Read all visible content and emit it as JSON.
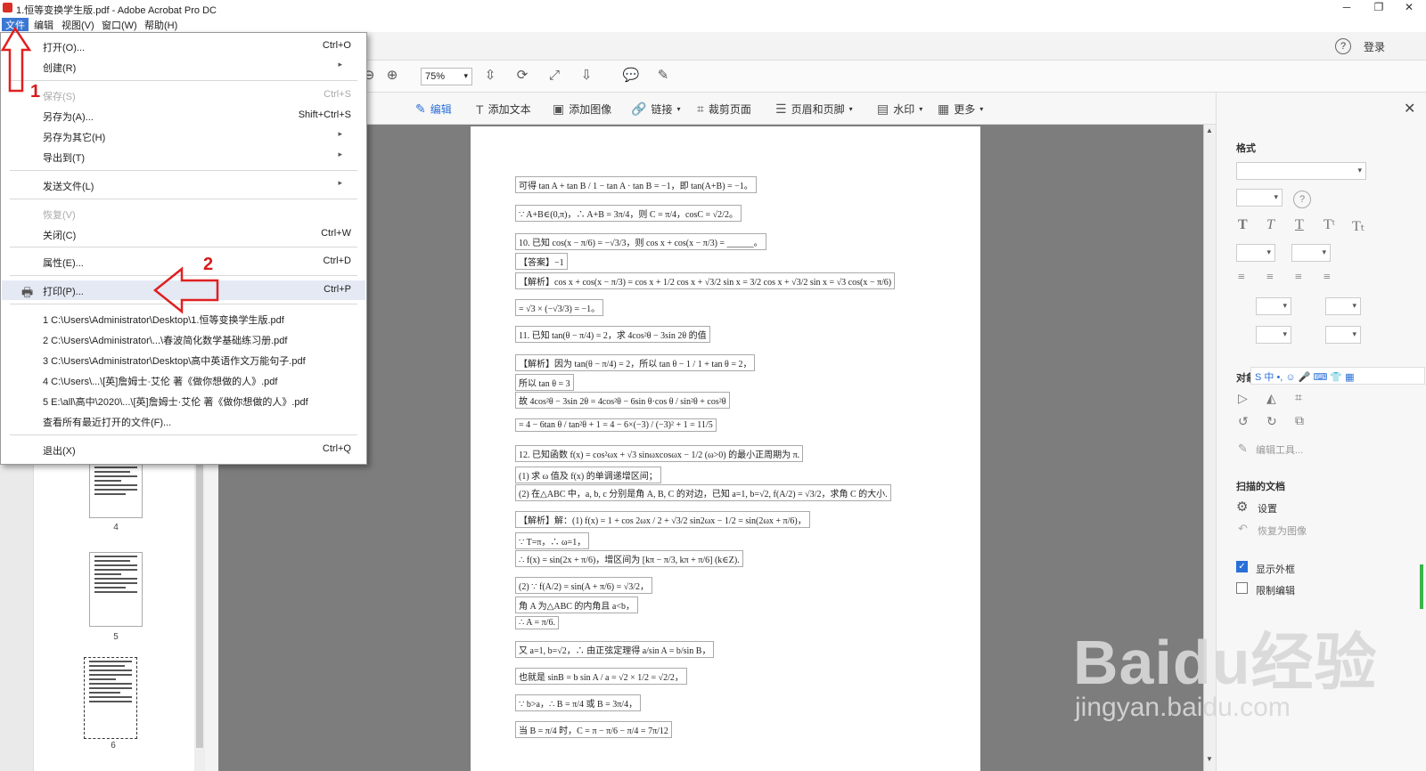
{
  "window": {
    "title": "1.恒等变换学生版.pdf - Adobe Acrobat Pro DC",
    "minimize": "─",
    "restore": "❐",
    "close": "✕"
  },
  "menubar": [
    "文件",
    "编辑",
    "视图(V)",
    "窗口(W)",
    "帮助(H)"
  ],
  "header": {
    "help": "?",
    "login": "登录"
  },
  "toolbar": {
    "zoom": "75%"
  },
  "edit_tools": [
    "编辑",
    "添加文本",
    "添加图像",
    "链接",
    "裁剪页面",
    "页眉和页脚",
    "水印",
    "更多"
  ],
  "file_menu": {
    "items": [
      {
        "label": "打开(O)...",
        "shortcut": "Ctrl+O"
      },
      {
        "label": "创建(R)",
        "shortcut": "",
        "submenu": true
      },
      {
        "label": "保存(S)",
        "shortcut": "Ctrl+S",
        "disabled": true
      },
      {
        "label": "另存为(A)...",
        "shortcut": "Shift+Ctrl+S"
      },
      {
        "label": "另存为其它(H)",
        "shortcut": "",
        "submenu": true
      },
      {
        "label": "导出到(T)",
        "shortcut": "",
        "submenu": true
      },
      {
        "label": "发送文件(L)",
        "shortcut": "",
        "submenu": true
      },
      {
        "label": "恢复(V)",
        "shortcut": "",
        "disabled": true
      },
      {
        "label": "关闭(C)",
        "shortcut": "Ctrl+W"
      },
      {
        "label": "属性(E)...",
        "shortcut": "Ctrl+D"
      },
      {
        "label": "打印(P)...",
        "shortcut": "Ctrl+P",
        "highlighted": true
      }
    ],
    "recent": [
      "1 C:\\Users\\Administrator\\Desktop\\1.恒等变换学生版.pdf",
      "2 C:\\Users\\Administrator\\...\\春波简化数学基础练习册.pdf",
      "3 C:\\Users\\Administrator\\Desktop\\高中英语作文万能句子.pdf",
      "4 C:\\Users\\...\\[英]詹姆士·艾伦 著《做你想做的人》.pdf",
      "5 E:\\all\\高中\\2020\\...\\[英]詹姆士·艾伦 著《做你想做的人》.pdf"
    ],
    "view_all": "查看所有最近打开的文件(F)...",
    "exit": {
      "label": "退出(X)",
      "shortcut": "Ctrl+Q"
    }
  },
  "annotations": {
    "one": "1",
    "two": "2"
  },
  "thumbnails": [
    "4",
    "5",
    "6"
  ],
  "document_lines": [
    "可得 tan A + tan B / 1 − tan A · tan B = −1，即 tan(A+B) = −1。",
    "∵ A+B∈(0,π)，∴ A+B = 3π/4，则 C = π/4，cosC = √2/2。",
    "10. 已知 cos(x − π/6) = −√3/3，则 cos x + cos(x − π/3) = ______。",
    "【答案】−1",
    "【解析】cos x + cos(x − π/3) = cos x + 1/2 cos x + √3/2 sin x = 3/2 cos x + √3/2 sin x = √3 cos(x − π/6)",
    "= √3 × (−√3/3) = −1。",
    "11. 已知 tan(θ − π/4) = 2，求 4cos²θ − 3sin 2θ 的值",
    "【解析】因为 tan(θ − π/4) = 2，所以 tan θ − 1 / 1 + tan θ = 2，",
    "所以 tan θ = 3",
    "故 4cos²θ − 3sin 2θ = 4cos²θ − 6sin θ·cos θ / sin²θ + cos²θ",
    "= 4 − 6tan θ / tan²θ + 1 = 4 − 6×(−3) / (−3)² + 1 = 11/5",
    "12. 已知函数 f(x) = cos²ωx + √3 sinωxcosωx − 1/2 (ω>0) 的最小正周期为 π.",
    "(1) 求 ω 值及 f(x) 的单调递增区间；",
    "(2) 在△ABC 中，a, b, c 分别是角 A, B, C 的对边，已知 a=1, b=√2, f(A/2) = √3/2，求角 C 的大小.",
    "【解析】解：(1) f(x) = 1 + cos 2ωx / 2 + √3/2 sin2ωx − 1/2 = sin(2ωx + π/6)，",
    "∵ T=π，∴ ω=1，",
    "∴ f(x) = sin(2x + π/6)，增区间为 [kπ − π/3, kπ + π/6] (k∈Z).",
    "(2) ∵ f(A/2) = sin(A + π/6) = √3/2，",
    "角 A 为△ABC 的内角且 a<b，",
    "∴ A = π/6.",
    "又 a=1, b=√2，∴ 由正弦定理得 a/sin A = b/sin B，",
    "也就是 sinB = b sin A / a = √2 × 1/2 = √2/2，",
    "∵ b>a，∴ B = π/4 或 B = 3π/4，",
    "当 B = π/4 时，C = π − π/6 − π/4 = 7π/12"
  ],
  "right_panel": {
    "format_title": "格式",
    "object_title": "对象",
    "edit_tools": "编辑工具...",
    "scanned_title": "扫描的文档",
    "settings": "设置",
    "revert_image": "恢复为图像",
    "show_bbox": "显示外框",
    "restrict_edit": "限制编辑"
  },
  "watermark": {
    "main": "Baidu经验",
    "sub": "jingyan.baidu.com"
  }
}
